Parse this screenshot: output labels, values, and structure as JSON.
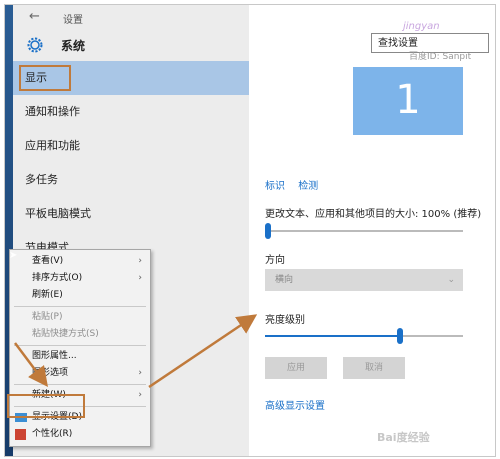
{
  "window": {
    "back_glyph": "←",
    "title": "设置",
    "app_title": "系统"
  },
  "search": {
    "label": "查找设置"
  },
  "watermark": {
    "top": "jingyan",
    "baidu_id": "百度ID: Sanpit",
    "bottom": "Bai度经验"
  },
  "sidebar": {
    "items": [
      {
        "label": "显示"
      },
      {
        "label": "通知和操作"
      },
      {
        "label": "应用和功能"
      },
      {
        "label": "多任务"
      },
      {
        "label": "平板电脑模式"
      },
      {
        "label": "节电模式"
      }
    ]
  },
  "display": {
    "monitor_number": "1",
    "identify": "标识",
    "detect": "检测",
    "scale_label": "更改文本、应用和其他项目的大小: 100% (推荐)",
    "scale_level": 0,
    "orientation_label": "方向",
    "orientation_value": "横向",
    "brightness_label": "亮度级别",
    "brightness_level": 0.68,
    "apply": "应用",
    "cancel": "取消",
    "advanced": "高级显示设置"
  },
  "context_menu": {
    "items": [
      {
        "label": "查看(V)",
        "submenu": true
      },
      {
        "label": "排序方式(O)",
        "submenu": true
      },
      {
        "label": "刷新(E)"
      },
      {
        "label": "粘贴(P)",
        "disabled": true
      },
      {
        "label": "粘贴快捷方式(S)",
        "disabled": true
      },
      {
        "label": "图形属性..."
      },
      {
        "label": "图形选项",
        "submenu": true
      },
      {
        "label": "新建(W)",
        "submenu": true
      },
      {
        "label": "显示设置(D)"
      },
      {
        "label": "个性化(R)"
      }
    ],
    "arrow_glyph": "›"
  },
  "colors": {
    "accent": "#1a70c8",
    "highlight_box": "#c07a3b",
    "active_nav": "#a9c6e6",
    "monitor": "#7db4ea"
  }
}
